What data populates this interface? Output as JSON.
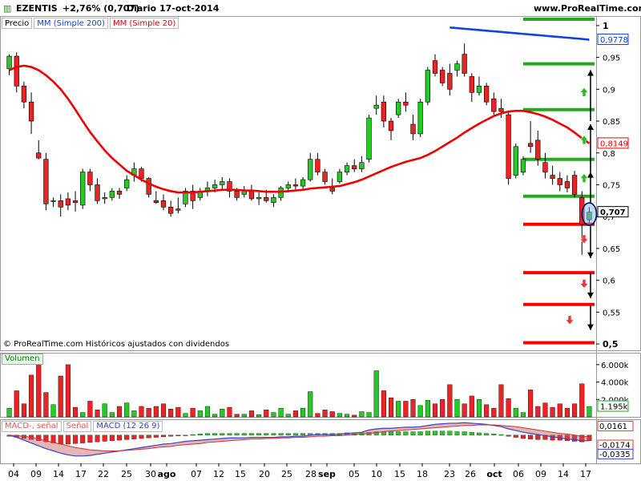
{
  "header": {
    "ticker": "EZENTIS",
    "change": "+2,76% (0,707)",
    "period": "Diario",
    "date": "17-oct-2014",
    "site": "www.ProRealTime.com"
  },
  "legend": {
    "price": "Precio",
    "ma200": "MM (Simple 200)",
    "ma20": "MM (Simple 20)"
  },
  "copyright": "© ProRealTime.com Históricos ajustados con dividendos",
  "volume_label": "Volumen",
  "macd_legend": {
    "diff": "MACD-, señal",
    "signal": "Señal",
    "macd": "MACD (12 26 9)"
  },
  "colors": {
    "up": "#22cc22",
    "down": "#ee2222",
    "ma20": "#ee0000",
    "ma200": "#1144dd",
    "support": "#ff0000",
    "resistance": "#22aa22",
    "arrow_down": "#ee3333",
    "arrow_up": "#22bb22"
  },
  "chart_data": [
    {
      "type": "candlestick",
      "title": "EZENTIS",
      "x_tick_labels": [
        "04",
        "09",
        "14",
        "17",
        "22",
        "25",
        "30",
        "ago",
        "07",
        "12",
        "15",
        "20",
        "25",
        "28",
        "sep",
        "05",
        "10",
        "15",
        "18",
        "23",
        "26",
        "oct",
        "06",
        "09",
        "14",
        "17"
      ],
      "y_ticks": [
        1,
        0.95,
        0.9,
        0.85,
        0.8,
        0.75,
        0.7,
        0.65,
        0.6,
        0.55,
        0.5
      ],
      "y_tick_labels": [
        "1",
        "0,95",
        "0,9",
        "0,85",
        "0,8",
        "0,75",
        "0,7",
        "0,65",
        "0,6",
        "0,55",
        "0,5"
      ],
      "ylim": [
        0.49,
        1.015
      ],
      "value_labels": [
        {
          "label": "0,9778",
          "value": 0.9778
        },
        {
          "label": "0,8149",
          "value": 0.8149
        },
        {
          "label": "0,707",
          "value": 0.707
        }
      ],
      "candles": [
        {
          "o": 0.932,
          "h": 0.955,
          "l": 0.922,
          "c": 0.952
        },
        {
          "o": 0.952,
          "h": 0.958,
          "l": 0.895,
          "c": 0.905
        },
        {
          "o": 0.905,
          "h": 0.912,
          "l": 0.87,
          "c": 0.88
        },
        {
          "o": 0.88,
          "h": 0.895,
          "l": 0.83,
          "c": 0.85
        },
        {
          "o": 0.8,
          "h": 0.82,
          "l": 0.79,
          "c": 0.792
        },
        {
          "o": 0.79,
          "h": 0.8,
          "l": 0.71,
          "c": 0.72
        },
        {
          "o": 0.725,
          "h": 0.73,
          "l": 0.715,
          "c": 0.725
        },
        {
          "o": 0.725,
          "h": 0.735,
          "l": 0.7,
          "c": 0.715
        },
        {
          "o": 0.728,
          "h": 0.738,
          "l": 0.71,
          "c": 0.718
        },
        {
          "o": 0.725,
          "h": 0.74,
          "l": 0.708,
          "c": 0.722
        },
        {
          "o": 0.718,
          "h": 0.775,
          "l": 0.712,
          "c": 0.77
        },
        {
          "o": 0.77,
          "h": 0.775,
          "l": 0.74,
          "c": 0.75
        },
        {
          "o": 0.75,
          "h": 0.76,
          "l": 0.72,
          "c": 0.725
        },
        {
          "o": 0.728,
          "h": 0.738,
          "l": 0.72,
          "c": 0.73
        },
        {
          "o": 0.73,
          "h": 0.745,
          "l": 0.725,
          "c": 0.74
        },
        {
          "o": 0.74,
          "h": 0.745,
          "l": 0.728,
          "c": 0.735
        },
        {
          "o": 0.745,
          "h": 0.765,
          "l": 0.74,
          "c": 0.758
        },
        {
          "o": 0.765,
          "h": 0.785,
          "l": 0.755,
          "c": 0.775
        },
        {
          "o": 0.775,
          "h": 0.778,
          "l": 0.755,
          "c": 0.76
        },
        {
          "o": 0.76,
          "h": 0.762,
          "l": 0.73,
          "c": 0.735
        },
        {
          "o": 0.725,
          "h": 0.74,
          "l": 0.72,
          "c": 0.722
        },
        {
          "o": 0.725,
          "h": 0.735,
          "l": 0.71,
          "c": 0.715
        },
        {
          "o": 0.715,
          "h": 0.725,
          "l": 0.7,
          "c": 0.705
        },
        {
          "o": 0.712,
          "h": 0.73,
          "l": 0.705,
          "c": 0.71
        },
        {
          "o": 0.72,
          "h": 0.745,
          "l": 0.715,
          "c": 0.74
        },
        {
          "o": 0.74,
          "h": 0.75,
          "l": 0.712,
          "c": 0.725
        },
        {
          "o": 0.73,
          "h": 0.745,
          "l": 0.725,
          "c": 0.74
        },
        {
          "o": 0.74,
          "h": 0.755,
          "l": 0.732,
          "c": 0.745
        },
        {
          "o": 0.745,
          "h": 0.758,
          "l": 0.738,
          "c": 0.75
        },
        {
          "o": 0.75,
          "h": 0.762,
          "l": 0.742,
          "c": 0.755
        },
        {
          "o": 0.755,
          "h": 0.76,
          "l": 0.73,
          "c": 0.74
        },
        {
          "o": 0.74,
          "h": 0.745,
          "l": 0.725,
          "c": 0.73
        },
        {
          "o": 0.735,
          "h": 0.748,
          "l": 0.73,
          "c": 0.742
        },
        {
          "o": 0.742,
          "h": 0.75,
          "l": 0.725,
          "c": 0.728
        },
        {
          "o": 0.728,
          "h": 0.738,
          "l": 0.718,
          "c": 0.73
        },
        {
          "o": 0.73,
          "h": 0.742,
          "l": 0.722,
          "c": 0.725
        },
        {
          "o": 0.722,
          "h": 0.735,
          "l": 0.715,
          "c": 0.73
        },
        {
          "o": 0.73,
          "h": 0.748,
          "l": 0.725,
          "c": 0.745
        },
        {
          "o": 0.745,
          "h": 0.755,
          "l": 0.738,
          "c": 0.75
        },
        {
          "o": 0.75,
          "h": 0.76,
          "l": 0.74,
          "c": 0.748
        },
        {
          "o": 0.748,
          "h": 0.762,
          "l": 0.742,
          "c": 0.758
        },
        {
          "o": 0.758,
          "h": 0.8,
          "l": 0.755,
          "c": 0.79
        },
        {
          "o": 0.79,
          "h": 0.8,
          "l": 0.765,
          "c": 0.77
        },
        {
          "o": 0.77,
          "h": 0.775,
          "l": 0.75,
          "c": 0.755
        },
        {
          "o": 0.745,
          "h": 0.76,
          "l": 0.735,
          "c": 0.74
        },
        {
          "o": 0.755,
          "h": 0.775,
          "l": 0.752,
          "c": 0.77
        },
        {
          "o": 0.77,
          "h": 0.785,
          "l": 0.765,
          "c": 0.78
        },
        {
          "o": 0.78,
          "h": 0.79,
          "l": 0.77,
          "c": 0.775
        },
        {
          "o": 0.775,
          "h": 0.795,
          "l": 0.77,
          "c": 0.785
        },
        {
          "o": 0.79,
          "h": 0.86,
          "l": 0.785,
          "c": 0.855
        },
        {
          "o": 0.87,
          "h": 0.89,
          "l": 0.86,
          "c": 0.875
        },
        {
          "o": 0.88,
          "h": 0.89,
          "l": 0.84,
          "c": 0.85
        },
        {
          "o": 0.85,
          "h": 0.855,
          "l": 0.82,
          "c": 0.835
        },
        {
          "o": 0.86,
          "h": 0.885,
          "l": 0.855,
          "c": 0.88
        },
        {
          "o": 0.88,
          "h": 0.895,
          "l": 0.865,
          "c": 0.875
        },
        {
          "o": 0.845,
          "h": 0.86,
          "l": 0.82,
          "c": 0.83
        },
        {
          "o": 0.83,
          "h": 0.885,
          "l": 0.825,
          "c": 0.88
        },
        {
          "o": 0.88,
          "h": 0.935,
          "l": 0.875,
          "c": 0.93
        },
        {
          "o": 0.945,
          "h": 0.955,
          "l": 0.92,
          "c": 0.925
        },
        {
          "o": 0.93,
          "h": 0.935,
          "l": 0.905,
          "c": 0.91
        },
        {
          "o": 0.925,
          "h": 0.94,
          "l": 0.89,
          "c": 0.9
        },
        {
          "o": 0.93,
          "h": 0.945,
          "l": 0.92,
          "c": 0.94
        },
        {
          "o": 0.955,
          "h": 0.972,
          "l": 0.92,
          "c": 0.925
        },
        {
          "o": 0.92,
          "h": 0.925,
          "l": 0.88,
          "c": 0.895
        },
        {
          "o": 0.895,
          "h": 0.92,
          "l": 0.89,
          "c": 0.905
        },
        {
          "o": 0.905,
          "h": 0.91,
          "l": 0.875,
          "c": 0.88
        },
        {
          "o": 0.885,
          "h": 0.895,
          "l": 0.86,
          "c": 0.865
        },
        {
          "o": 0.87,
          "h": 0.885,
          "l": 0.855,
          "c": 0.865
        },
        {
          "o": 0.86,
          "h": 0.865,
          "l": 0.75,
          "c": 0.76
        },
        {
          "o": 0.765,
          "h": 0.815,
          "l": 0.76,
          "c": 0.81
        },
        {
          "o": 0.77,
          "h": 0.795,
          "l": 0.765,
          "c": 0.79
        },
        {
          "o": 0.815,
          "h": 0.85,
          "l": 0.8,
          "c": 0.81
        },
        {
          "o": 0.82,
          "h": 0.835,
          "l": 0.78,
          "c": 0.79
        },
        {
          "o": 0.785,
          "h": 0.8,
          "l": 0.76,
          "c": 0.77
        },
        {
          "o": 0.765,
          "h": 0.78,
          "l": 0.75,
          "c": 0.76
        },
        {
          "o": 0.76,
          "h": 0.77,
          "l": 0.74,
          "c": 0.75
        },
        {
          "o": 0.755,
          "h": 0.765,
          "l": 0.738,
          "c": 0.745
        },
        {
          "o": 0.765,
          "h": 0.772,
          "l": 0.73,
          "c": 0.735
        },
        {
          "o": 0.73,
          "h": 0.74,
          "l": 0.64,
          "c": 0.688
        },
        {
          "o": 0.695,
          "h": 0.715,
          "l": 0.69,
          "c": 0.707
        }
      ],
      "ma20": [
        0.93,
        0.935,
        0.937,
        0.935,
        0.93,
        0.922,
        0.912,
        0.9,
        0.885,
        0.868,
        0.85,
        0.833,
        0.818,
        0.804,
        0.792,
        0.782,
        0.772,
        0.765,
        0.758,
        0.752,
        0.747,
        0.743,
        0.74,
        0.738,
        0.738,
        0.738,
        0.739,
        0.74,
        0.741,
        0.742,
        0.742,
        0.742,
        0.741,
        0.741,
        0.74,
        0.739,
        0.739,
        0.739,
        0.74,
        0.741,
        0.742,
        0.744,
        0.745,
        0.746,
        0.747,
        0.748,
        0.751,
        0.754,
        0.758,
        0.763,
        0.768,
        0.773,
        0.778,
        0.782,
        0.786,
        0.789,
        0.792,
        0.797,
        0.803,
        0.81,
        0.817,
        0.824,
        0.832,
        0.839,
        0.846,
        0.852,
        0.858,
        0.862,
        0.865,
        0.866,
        0.866,
        0.864,
        0.861,
        0.857,
        0.852,
        0.846,
        0.84,
        0.832,
        0.823,
        0.815
      ],
      "ma200_tail": [
        0.997,
        0.996,
        0.995,
        0.994,
        0.993,
        0.992,
        0.991,
        0.99,
        0.989,
        0.988,
        0.987,
        0.986,
        0.985,
        0.984,
        0.983,
        0.982,
        0.981,
        0.98,
        0.979,
        0.9778
      ],
      "support_levels": [
        0.688,
        0.612,
        0.562,
        0.502
      ],
      "resistance_levels": [
        1.01,
        0.94,
        0.868,
        0.79,
        0.732
      ]
    },
    {
      "type": "bar",
      "title": "Volumen",
      "y_tick_labels": [
        "6.000k",
        "4.000k",
        "2.000k"
      ],
      "y_ticks": [
        6000,
        4000,
        2000
      ],
      "ylim": [
        0,
        7000
      ],
      "value_labels": [
        {
          "label": "1.195k",
          "value": 1195
        }
      ],
      "values": [
        1000,
        3000,
        1500,
        4800,
        6700,
        2800,
        1400,
        4700,
        6000,
        1100,
        500,
        1800,
        800,
        1500,
        500,
        1200,
        1600,
        700,
        1200,
        1000,
        1200,
        1500,
        900,
        1100,
        400,
        1000,
        700,
        1200,
        300,
        900,
        1100,
        300,
        300,
        700,
        250,
        800,
        500,
        1000,
        300,
        700,
        1000,
        2900,
        400,
        800,
        600,
        400,
        300,
        200,
        600,
        500,
        5300,
        3000,
        2200,
        1800,
        1800,
        2000,
        1300,
        1900,
        1500,
        2000,
        3700,
        2000,
        1500,
        2400,
        2000,
        1400,
        1000,
        3700,
        2100,
        1000,
        500,
        3100,
        1200,
        1600,
        1100,
        1500,
        1000,
        1500,
        3800,
        1195
      ]
    },
    {
      "type": "bar",
      "title": "MACD (12 26 9)",
      "y_tick_labels": [
        "0,0161",
        "-0,0174",
        "-0,0335"
      ],
      "y_ticks": [
        0.0161,
        -0.0174,
        -0.0335
      ],
      "ylim": [
        -0.05,
        0.028
      ],
      "histogram": [
        -0.002,
        -0.004,
        -0.006,
        -0.008,
        -0.01,
        -0.012,
        -0.014,
        -0.016,
        -0.016,
        -0.015,
        -0.014,
        -0.013,
        -0.012,
        -0.011,
        -0.01,
        -0.009,
        -0.008,
        -0.007,
        -0.006,
        -0.005,
        -0.004,
        -0.003,
        -0.002,
        -0.001,
        0.0,
        0.001,
        0.002,
        0.003,
        0.003,
        0.003,
        0.003,
        0.003,
        0.003,
        0.003,
        0.003,
        0.003,
        0.003,
        0.003,
        0.003,
        0.003,
        0.003,
        0.003,
        0.003,
        0.003,
        0.003,
        0.003,
        0.004,
        0.004,
        0.004,
        0.005,
        0.006,
        0.006,
        0.006,
        0.006,
        0.006,
        0.006,
        0.006,
        0.007,
        0.007,
        0.007,
        0.007,
        0.006,
        0.006,
        0.005,
        0.004,
        0.003,
        0.002,
        0.001,
        -0.002,
        -0.004,
        -0.006,
        -0.007,
        -0.008,
        -0.008,
        -0.009,
        -0.009,
        -0.01,
        -0.011,
        -0.012,
        -0.01
      ],
      "macd": [
        0.0,
        -0.004,
        -0.009,
        -0.014,
        -0.019,
        -0.024,
        -0.028,
        -0.032,
        -0.035,
        -0.037,
        -0.037,
        -0.036,
        -0.034,
        -0.032,
        -0.03,
        -0.028,
        -0.026,
        -0.024,
        -0.022,
        -0.02,
        -0.018,
        -0.016,
        -0.015,
        -0.013,
        -0.011,
        -0.01,
        -0.009,
        -0.008,
        -0.007,
        -0.006,
        -0.005,
        -0.005,
        -0.005,
        -0.004,
        -0.004,
        -0.004,
        -0.004,
        -0.003,
        -0.003,
        -0.002,
        -0.002,
        0.0,
        0.001,
        0.001,
        0.001,
        0.002,
        0.003,
        0.004,
        0.005,
        0.009,
        0.011,
        0.012,
        0.012,
        0.013,
        0.014,
        0.014,
        0.015,
        0.017,
        0.019,
        0.02,
        0.021,
        0.021,
        0.022,
        0.021,
        0.02,
        0.019,
        0.017,
        0.015,
        0.011,
        0.008,
        0.005,
        0.003,
        0.001,
        -0.001,
        -0.003,
        -0.005,
        -0.007,
        -0.008,
        -0.01,
        -0.01
      ],
      "signal": [
        0.0,
        -0.001,
        -0.002,
        -0.004,
        -0.007,
        -0.01,
        -0.013,
        -0.016,
        -0.019,
        -0.022,
        -0.024,
        -0.026,
        -0.027,
        -0.028,
        -0.028,
        -0.028,
        -0.027,
        -0.026,
        -0.025,
        -0.024,
        -0.022,
        -0.021,
        -0.02,
        -0.018,
        -0.017,
        -0.016,
        -0.015,
        -0.013,
        -0.012,
        -0.011,
        -0.01,
        -0.009,
        -0.008,
        -0.007,
        -0.007,
        -0.006,
        -0.006,
        -0.005,
        -0.005,
        -0.004,
        -0.004,
        -0.003,
        -0.002,
        -0.002,
        -0.001,
        -0.001,
        0.0,
        0.001,
        0.002,
        0.003,
        0.004,
        0.006,
        0.007,
        0.008,
        0.009,
        0.01,
        0.011,
        0.012,
        0.013,
        0.014,
        0.015,
        0.016,
        0.017,
        0.017,
        0.018,
        0.018,
        0.018,
        0.017,
        0.016,
        0.015,
        0.013,
        0.011,
        0.009,
        0.007,
        0.005,
        0.003,
        0.002,
        0.0,
        -0.002,
        -0.003
      ]
    }
  ]
}
